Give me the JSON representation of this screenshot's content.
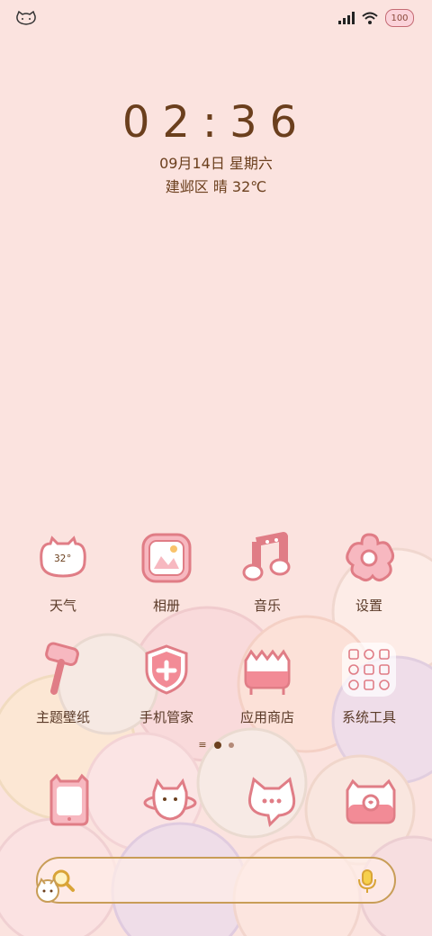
{
  "status": {
    "battery": "100",
    "left_icon": "cat-face-icon",
    "signal_icon": "signal-bars-icon",
    "wifi_icon": "wifi-icon"
  },
  "lockscreen": {
    "time": "02:36",
    "date": "09月14日 星期六",
    "weather": "建邺区 晴 32℃"
  },
  "apps_row1": [
    {
      "label": "天气",
      "icon": "weather-cat-icon",
      "badge": "32°"
    },
    {
      "label": "相册",
      "icon": "photo-album-icon"
    },
    {
      "label": "音乐",
      "icon": "music-note-icon"
    },
    {
      "label": "设置",
      "icon": "settings-flower-icon"
    }
  ],
  "apps_row2": [
    {
      "label": "主题壁纸",
      "icon": "paint-roller-icon"
    },
    {
      "label": "手机管家",
      "icon": "shield-cross-icon"
    },
    {
      "label": "应用商店",
      "icon": "store-cake-icon"
    },
    {
      "label": "系统工具",
      "icon": "system-tools-folder-icon"
    }
  ],
  "dock": [
    {
      "icon": "phone-cat-icon"
    },
    {
      "icon": "contacts-cat-icon"
    },
    {
      "icon": "message-cat-icon"
    },
    {
      "icon": "camera-cat-icon"
    }
  ],
  "page_indicator": {
    "pages": 2,
    "current": 1
  },
  "search": {
    "icon": "search-icon",
    "voice_icon": "microphone-icon"
  },
  "colors": {
    "background": "#fbe3df",
    "accent": "#e57f8a",
    "text": "#5a3a28",
    "search_border": "#c89d57"
  }
}
